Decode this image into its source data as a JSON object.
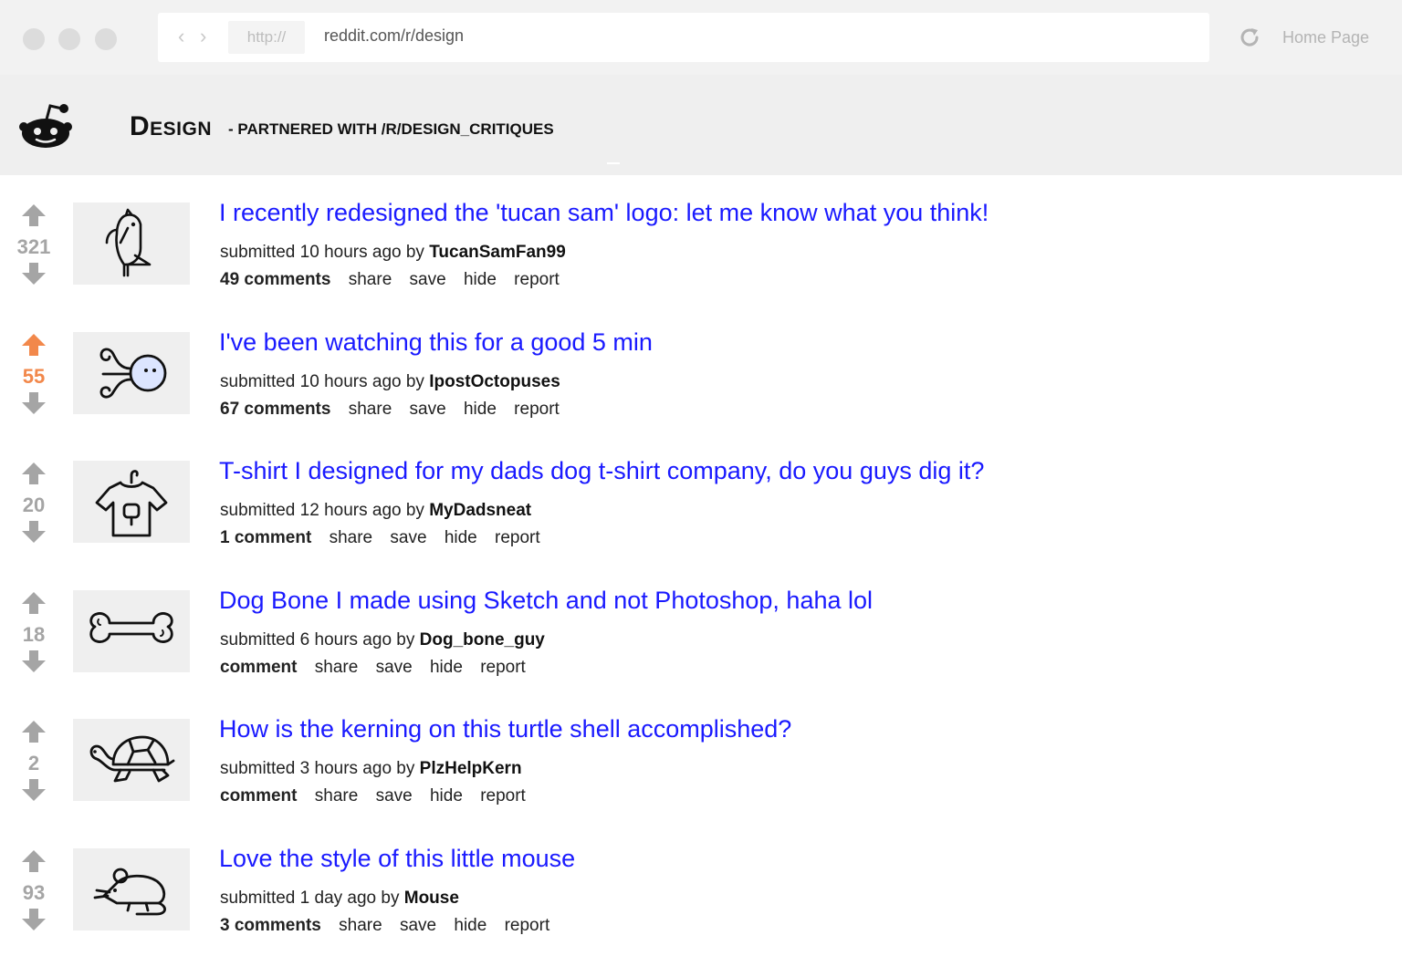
{
  "browser": {
    "protocol": "http://",
    "url": "reddit.com/r/design",
    "home_label": "Home Page"
  },
  "subreddit": {
    "title": "Design",
    "tagline": "- PARTNERED WITH /r/DESIGN_CRITIQUES"
  },
  "colors": {
    "link": "#1a1aff",
    "upvote_accent": "#f2884b",
    "vote_gray": "#a5a5a5"
  },
  "post_buttons": {
    "share": "share",
    "save": "save",
    "hide": "hide",
    "report": "report"
  },
  "posts": [
    {
      "score": "321",
      "upvoted": false,
      "icon": "bird-icon",
      "title": "I recently redesigned the 'tucan sam' logo: let me know what you think!",
      "submitted": "submitted 10 hours ago by",
      "author": "TucanSamFan99",
      "comments": "49 comments"
    },
    {
      "score": "55",
      "upvoted": true,
      "icon": "octopus-icon",
      "title": "I've been watching this for a good 5 min",
      "submitted": "submitted 10 hours ago by",
      "author": "IpostOctopuses",
      "comments": "67 comments"
    },
    {
      "score": "20",
      "upvoted": false,
      "icon": "tshirt-icon",
      "title": "T-shirt I designed for my dads dog t-shirt company, do you guys dig it?",
      "submitted": "submitted 12 hours ago by",
      "author": "MyDadsneat",
      "comments": "1 comment"
    },
    {
      "score": "18",
      "upvoted": false,
      "icon": "bone-icon",
      "title": "Dog Bone I made using Sketch and not Photoshop, haha lol",
      "submitted": "submitted 6 hours ago by",
      "author": "Dog_bone_guy",
      "comments": "comment"
    },
    {
      "score": "2",
      "upvoted": false,
      "icon": "turtle-icon",
      "title": "How is the kerning on this turtle shell accomplished?",
      "submitted": "submitted 3 hours ago by",
      "author": "PlzHelpKern",
      "comments": "comment"
    },
    {
      "score": "93",
      "upvoted": false,
      "icon": "mouse-icon",
      "title": "Love the style of this little mouse",
      "submitted": "submitted 1 day ago by",
      "author": "Mouse",
      "comments": "3 comments"
    }
  ]
}
